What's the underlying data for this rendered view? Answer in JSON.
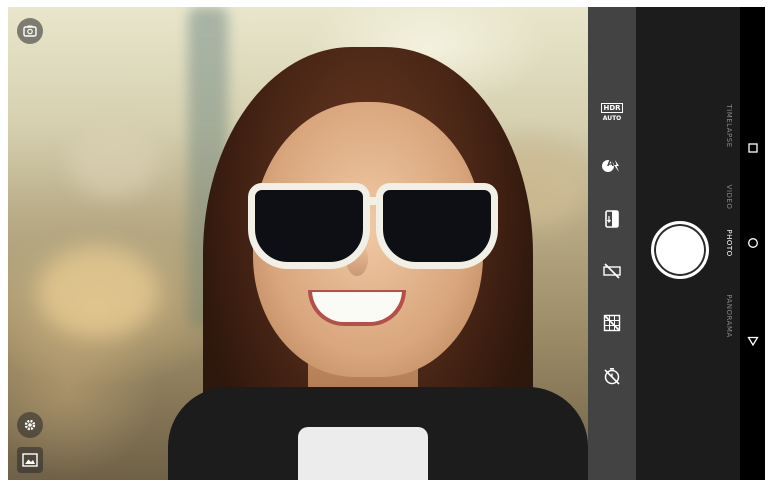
{
  "camera_modes": [
    "PANORAMA",
    "PHOTO",
    "VIDEO",
    "TIMELAPSE"
  ],
  "active_mode": "PHOTO",
  "settings": {
    "hdr_label": "HDR",
    "hdr_sub": "AUTO",
    "flash_label": "A"
  },
  "icons": {
    "top_left": "camera-switch-icon",
    "settings": "gear-icon",
    "gallery": "gallery-icon",
    "nav": [
      "recents-icon",
      "home-icon",
      "back-icon"
    ]
  },
  "colors": {
    "panel": "#464646",
    "shutter_bg": "#1c1c1c",
    "navbar": "#000000",
    "mode_inactive": "#8a8a8a",
    "mode_active": "#ffffff"
  }
}
